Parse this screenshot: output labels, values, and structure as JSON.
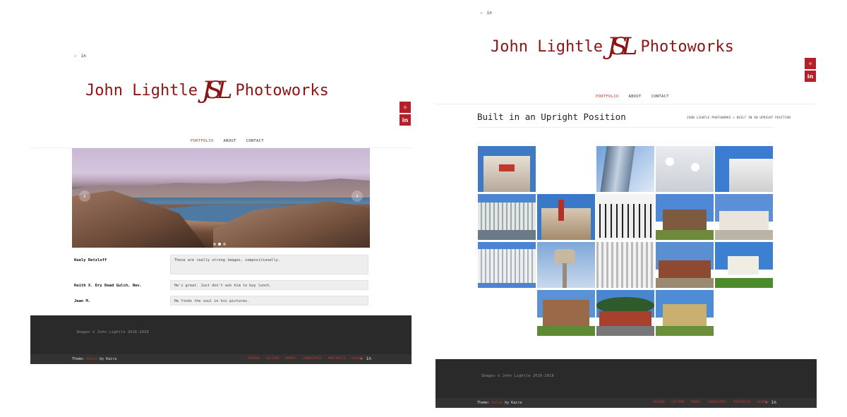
{
  "site": {
    "name_left": "John Lightle",
    "name_right": "Photoworks",
    "monogram": "JSL",
    "social": [
      "twitter-icon",
      "linkedin-icon"
    ],
    "social_glyphs": {
      "twitter": "✧",
      "linkedin": "in"
    }
  },
  "nav": [
    {
      "label": "PORTFOLIO",
      "active": true
    },
    {
      "label": "ABOUT",
      "active": false
    },
    {
      "label": "CONTACT",
      "active": false
    }
  ],
  "left": {
    "slider": {
      "prev": "‹",
      "next": "›",
      "dots": 3,
      "active_dot": 1
    },
    "reviews": [
      {
        "name": "Keely Retzloff",
        "text": "These are really strong images, compositionally."
      },
      {
        "name": "Keith X. Dry Dead Gulch, Nev.",
        "text": "He's great. Just don't ask him to buy lunch."
      },
      {
        "name": "Jean M.",
        "text": "He finds the soul in his pictures."
      }
    ]
  },
  "right": {
    "title": "Built in an Upright Position",
    "breadcrumb": "JOHN LIGHTLE PHOTOWORKS > BUILT IN AN UPRIGHT POSITION"
  },
  "footer": {
    "copyright": "Images © John Lightle 2016-2018",
    "theme_prefix": "Theme:",
    "theme_name": "Kalzo",
    "theme_suffix": "by Kaira",
    "links": [
      "SPHINX",
      "LECTURE",
      "MARKS",
      "LANDSCAPES",
      "PORTRAITS",
      "HAIKUS"
    ]
  },
  "colors": {
    "accent": "#c0392b",
    "logo": "#8b1515",
    "social_bg": "#b3202a",
    "footer_bg": "#2a2a2a"
  }
}
